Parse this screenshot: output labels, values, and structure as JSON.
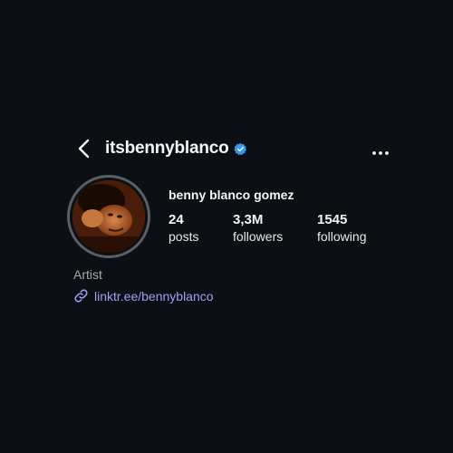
{
  "profile": {
    "username": "itsbennyblanco",
    "display_name": "benny blanco gomez",
    "category": "Artist",
    "link": "linktr.ee/bennyblanco",
    "verified_icon": "verified-badge-icon",
    "verified_color": "#3897f0"
  },
  "stats": [
    {
      "value": "24",
      "label": "posts"
    },
    {
      "value": "3,3M",
      "label": "followers"
    },
    {
      "value": "1545",
      "label": "following"
    }
  ],
  "icons": {
    "back": "chevron-left-icon",
    "more": "more-horizontal-icon",
    "link": "link-icon"
  },
  "colors": {
    "background": "#0c1014",
    "link": "#9e9ff5",
    "muted": "#a8a8a8"
  }
}
